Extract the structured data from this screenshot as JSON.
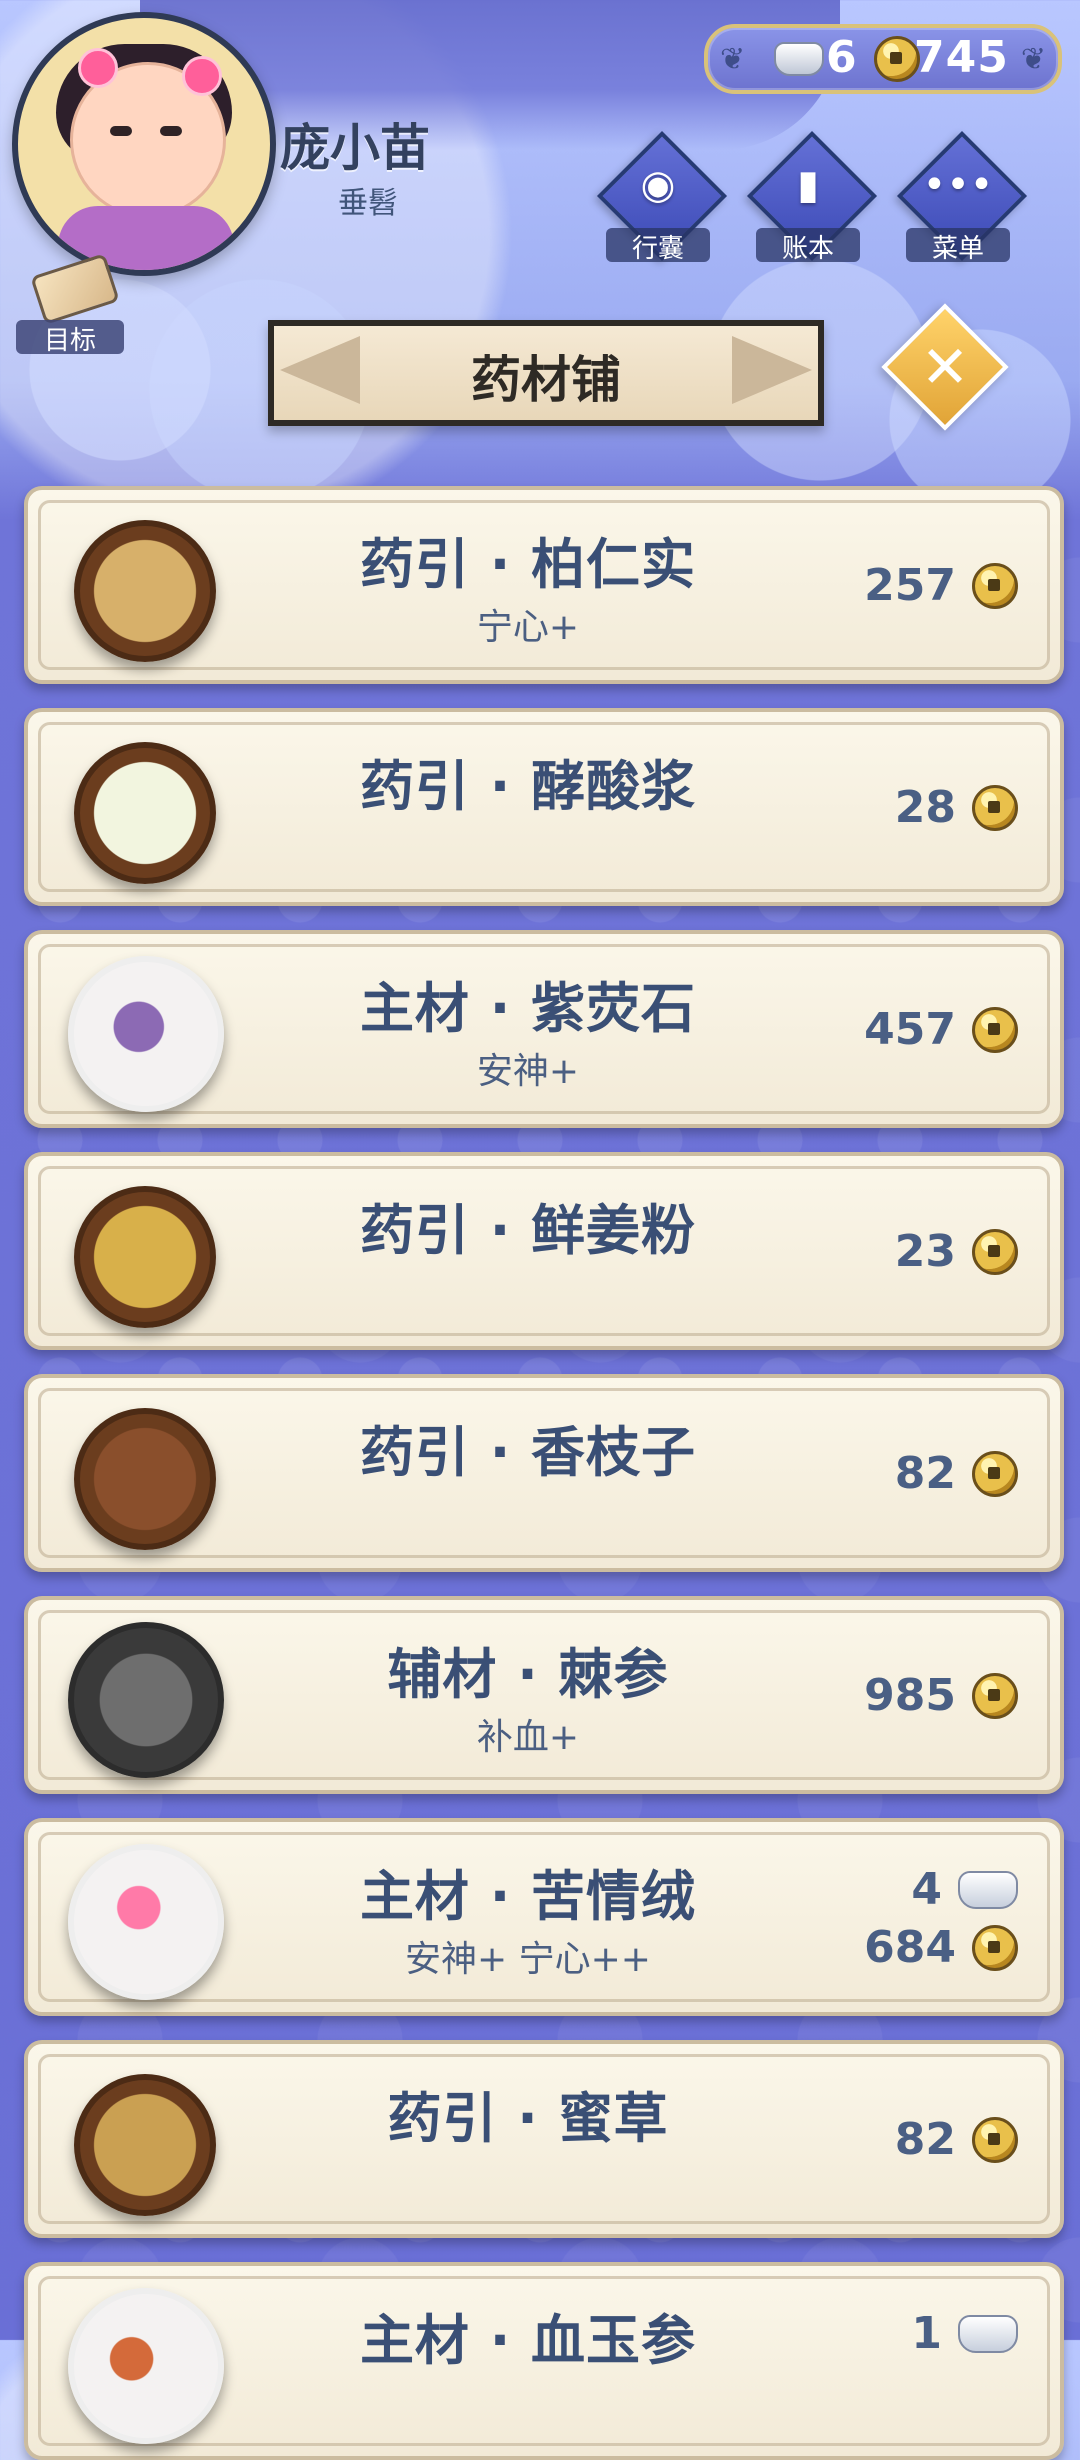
{
  "player": {
    "name": "庞小苗",
    "title": "垂髫"
  },
  "currency": {
    "silver": "6",
    "copper": "745"
  },
  "menu": [
    {
      "label": "行囊",
      "icon": "bag-icon"
    },
    {
      "label": "账本",
      "icon": "ledger-icon"
    },
    {
      "label": "菜单",
      "icon": "more-icon"
    }
  ],
  "goal": {
    "label": "目标",
    "icon": "scroll-icon"
  },
  "shop": {
    "title": "药材铺",
    "close_icon": "close-icon"
  },
  "items": [
    {
      "name": "药引 · 柏仁实",
      "effect": "宁心+",
      "price_copper": "257",
      "image": "seed-bowl"
    },
    {
      "name": "药引 · 酵酸浆",
      "effect": "",
      "price_copper": "28",
      "image": "milk-bowl"
    },
    {
      "name": "主材 · 紫荧石",
      "effect": "安神+",
      "price_copper": "457",
      "image": "amethyst-plate"
    },
    {
      "name": "药引 · 鲜姜粉",
      "effect": "",
      "price_copper": "23",
      "image": "ginger-bowl"
    },
    {
      "name": "药引 · 香枝子",
      "effect": "",
      "price_copper": "82",
      "image": "nuts-bowl"
    },
    {
      "name": "辅材 · 棘参",
      "effect": "补血+",
      "price_copper": "985",
      "image": "sea-cucumber-plate"
    },
    {
      "name": "主材 · 苦情绒",
      "effect": "安神+ 宁心++",
      "price_silver": "4",
      "price_copper": "684",
      "image": "flower-plate"
    },
    {
      "name": "药引 · 蜜草",
      "effect": "",
      "price_copper": "82",
      "image": "herb-bowl"
    },
    {
      "name": "主材 · 血玉参",
      "effect": "",
      "price_silver": "1",
      "price_copper": "",
      "image": "ginseng-plate"
    }
  ]
}
